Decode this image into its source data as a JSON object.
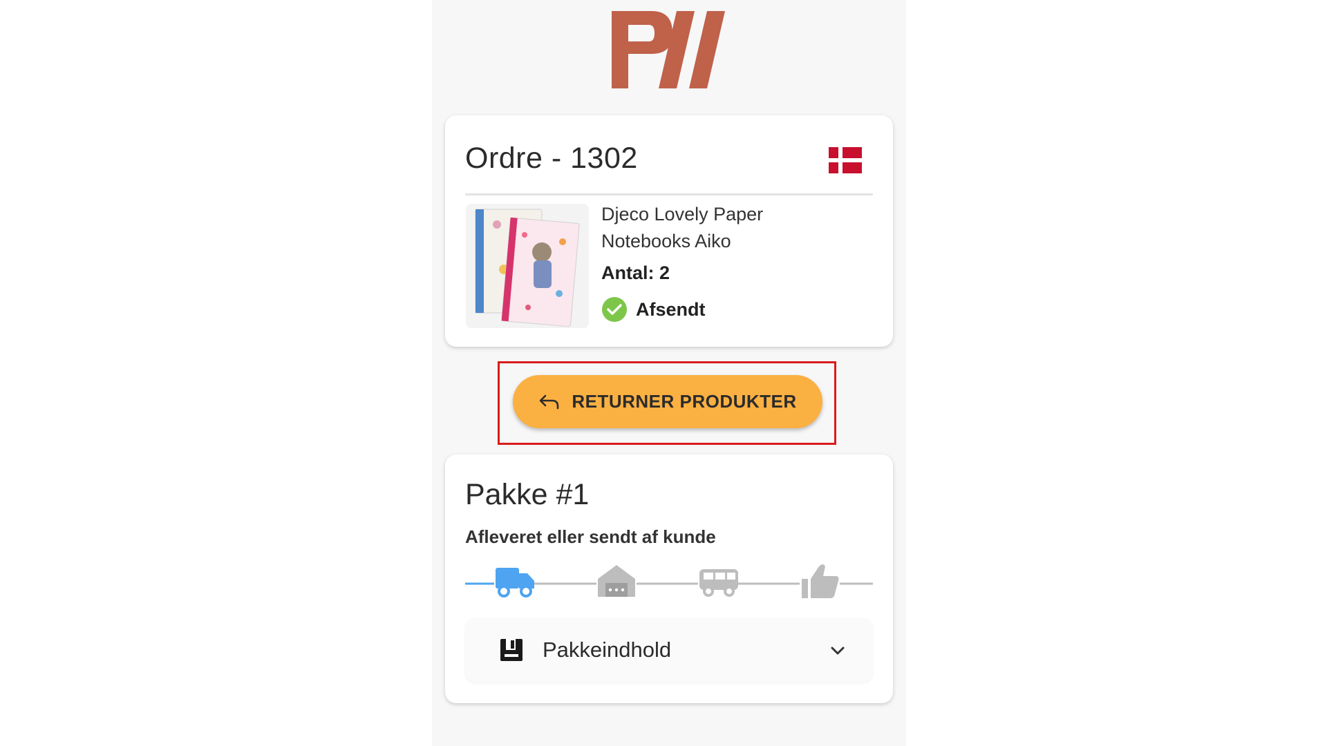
{
  "brand": {
    "logo_text": "PW",
    "logo_color": "#c0614a"
  },
  "order": {
    "title": "Ordre - 1302",
    "flag_icon": "danish-flag-icon",
    "product": {
      "name": "Djeco Lovely Paper Notebooks Aiko",
      "quantity": "Antal: 2",
      "status": "Afsendt",
      "status_icon": "check-circle-icon",
      "status_color": "#7dc64a"
    }
  },
  "actions": {
    "return_label": "RETURNER PRODUKTER",
    "return_icon": "undo-arrow-icon",
    "button_color": "#fbb042"
  },
  "package": {
    "title": "Pakke #1",
    "status_text": "Afleveret eller sendt af kunde",
    "tracking_steps": [
      {
        "icon": "truck-icon",
        "active": true
      },
      {
        "icon": "warehouse-icon",
        "active": false
      },
      {
        "icon": "delivery-van-icon",
        "active": false
      },
      {
        "icon": "thumbs-up-icon",
        "active": false
      }
    ],
    "active_color": "#4ea4f0",
    "inactive_color": "#bdbdbd",
    "contents_label": "Pakkeindhold",
    "contents_icon": "package-contents-icon"
  }
}
